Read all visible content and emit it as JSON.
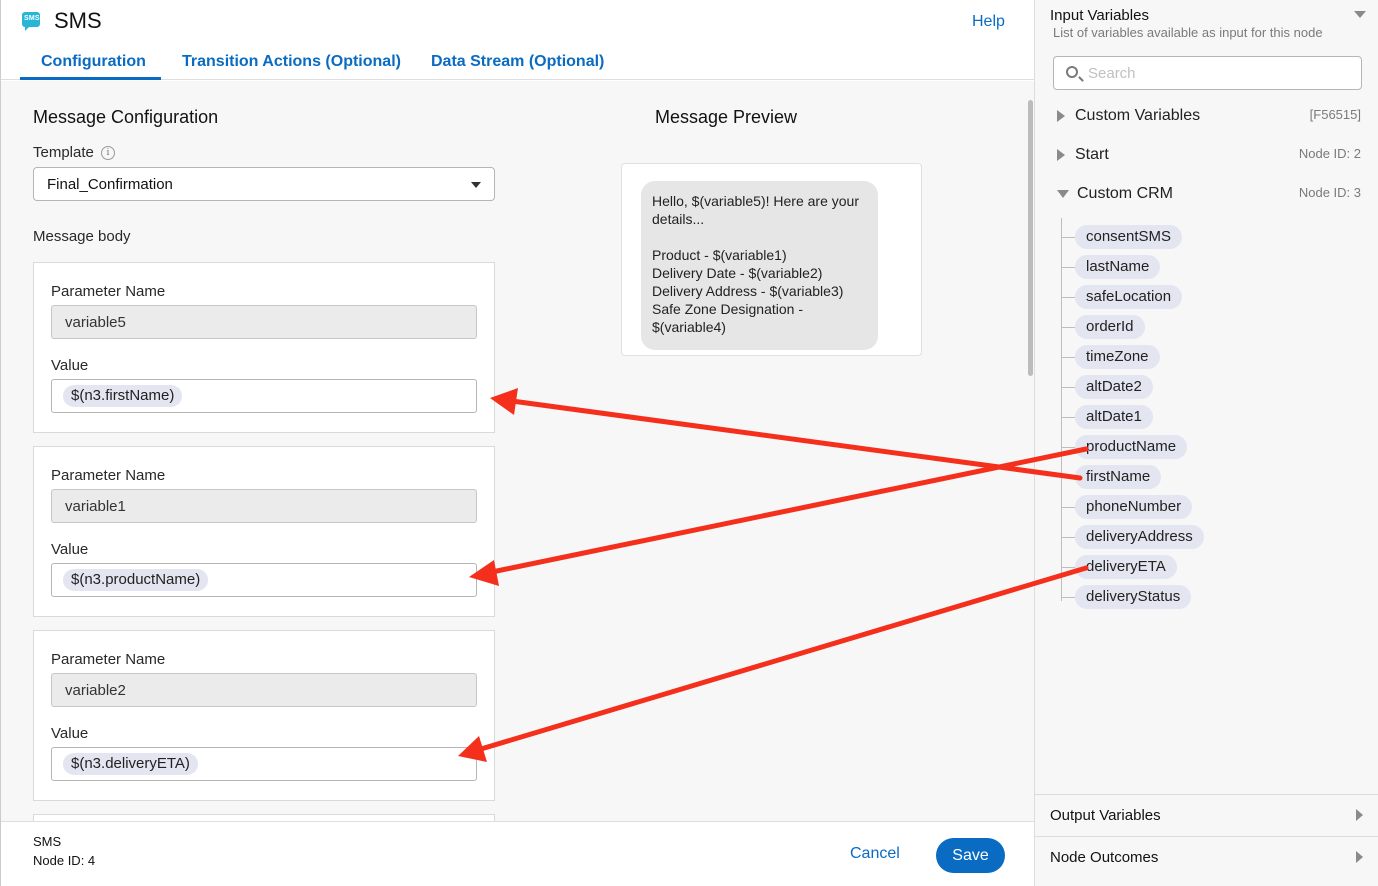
{
  "header": {
    "icon_text": "SMS",
    "title": "SMS",
    "help": "Help",
    "tabs": [
      {
        "label": "Configuration"
      },
      {
        "label": "Transition Actions (Optional)"
      },
      {
        "label": "Data Stream (Optional)"
      }
    ],
    "active_tab": "Configuration"
  },
  "config": {
    "section_title": "Message Configuration",
    "template_label": "Template",
    "template_info_icon": "info-icon",
    "template_value": "Final_Confirmation",
    "message_body_label": "Message body",
    "parameters": [
      {
        "name_label": "Parameter Name",
        "name": "variable5",
        "value_label": "Value",
        "value": "$(n3.firstName)"
      },
      {
        "name_label": "Parameter Name",
        "name": "variable1",
        "value_label": "Value",
        "value": "$(n3.productName)"
      },
      {
        "name_label": "Parameter Name",
        "name": "variable2",
        "value_label": "Value",
        "value": "$(n3.deliveryETA)"
      }
    ]
  },
  "preview": {
    "title": "Message Preview",
    "text": "Hello, $(variable5)! Here are your details...\n\nProduct - $(variable1)\nDelivery Date - $(variable2)\nDelivery Address - $(variable3)\nSafe Zone Designation - $(variable4)"
  },
  "footer": {
    "node_name": "SMS",
    "node_id": "Node ID: 4",
    "cancel": "Cancel",
    "save": "Save"
  },
  "input_panel": {
    "title": "Input Variables",
    "subtitle": "List of variables available as input for this node",
    "search_placeholder": "Search",
    "nodes": [
      {
        "label": "Custom Variables",
        "meta": "[F56515]",
        "expanded": false
      },
      {
        "label": "Start",
        "meta": "Node ID: 2",
        "expanded": false
      },
      {
        "label": "Custom CRM",
        "meta": "Node ID: 3",
        "expanded": true
      }
    ],
    "crm_variables": [
      "consentSMS",
      "lastName",
      "safeLocation",
      "orderId",
      "timeZone",
      "altDate2",
      "altDate1",
      "productName",
      "firstName",
      "phoneNumber",
      "deliveryAddress",
      "deliveryETA",
      "deliveryStatus"
    ],
    "output_variables": "Output Variables",
    "node_outcomes": "Node Outcomes"
  },
  "colors": {
    "accent": "#0a6bc2",
    "chip": "#e3e5f0",
    "annotation_arrow": "#f4301c"
  }
}
